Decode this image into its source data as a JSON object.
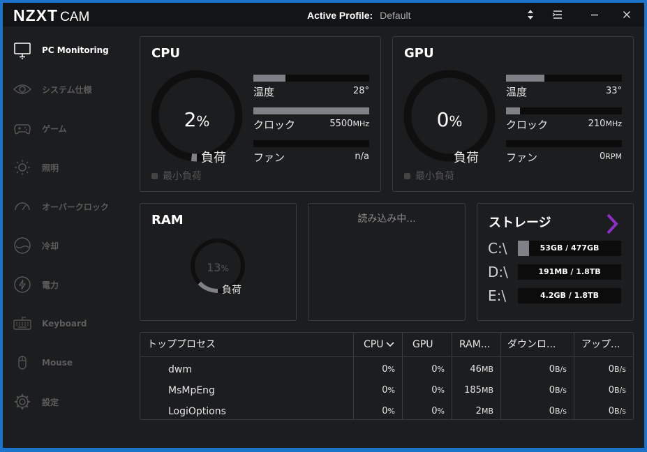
{
  "app": {
    "brand": "NZXT",
    "product": "CAM"
  },
  "header": {
    "profile_label": "Active Profile:",
    "profile_value": "Default"
  },
  "sidebar": {
    "items": [
      {
        "label": "PC Monitoring",
        "icon": "monitor-icon",
        "active": true
      },
      {
        "label": "システム仕様",
        "icon": "eye-icon"
      },
      {
        "label": "ゲーム",
        "icon": "gamepad-icon"
      },
      {
        "label": "照明",
        "icon": "light-icon"
      },
      {
        "label": "オーバークロック",
        "icon": "speedometer-icon"
      },
      {
        "label": "冷却",
        "icon": "cooling-icon"
      },
      {
        "label": "電力",
        "icon": "power-icon"
      },
      {
        "label": "Keyboard",
        "icon": "keyboard-icon"
      },
      {
        "label": "Mouse",
        "icon": "mouse-icon"
      },
      {
        "label": "設定",
        "icon": "gear-icon"
      }
    ]
  },
  "cpu": {
    "title": "CPU",
    "load_value": "2",
    "load_unit": "%",
    "load_fraction": 0.02,
    "load_label": "負荷",
    "min_load_label": "最小負荷",
    "temp_label": "温度",
    "temp_value": "28°",
    "temp_fraction": 0.28,
    "clock_label": "クロック",
    "clock_value": "5500",
    "clock_unit": "MHz",
    "clock_fraction": 1.0,
    "fan_label": "ファン",
    "fan_value": "n/a",
    "fan_unit": "",
    "fan_fraction": 0
  },
  "gpu": {
    "title": "GPU",
    "load_value": "0",
    "load_unit": "%",
    "load_fraction": 0.0,
    "load_label": "負荷",
    "min_load_label": "最小負荷",
    "temp_label": "温度",
    "temp_value": "33°",
    "temp_fraction": 0.33,
    "clock_label": "クロック",
    "clock_value": "210",
    "clock_unit": "MHz",
    "clock_fraction": 0.12,
    "fan_label": "ファン",
    "fan_value": "0",
    "fan_unit": "RPM",
    "fan_fraction": 0
  },
  "ram": {
    "title": "RAM",
    "load_value": "13",
    "load_unit": "%",
    "load_fraction": 0.13,
    "load_label": "負荷"
  },
  "middle": {
    "loading_text": "読み込み中..."
  },
  "storage": {
    "title": "ストレージ",
    "drives": [
      {
        "letter": "C:\\",
        "usage": "53GB / 477GB",
        "fraction": 0.11
      },
      {
        "letter": "D:\\",
        "usage": "191MB / 1.8TB",
        "fraction": 0
      },
      {
        "letter": "E:\\",
        "usage": "4.2GB / 1.8TB",
        "fraction": 0
      }
    ]
  },
  "processes": {
    "headers": {
      "name": "トッププロセス",
      "cpu": "CPU",
      "gpu": "GPU",
      "ram": "RAM...",
      "download": "ダウンロ...",
      "upload": "アップ..."
    },
    "rows": [
      {
        "name": "dwm",
        "cpu": "0",
        "cpu_unit": "%",
        "gpu": "0",
        "gpu_unit": "%",
        "ram": "46",
        "ram_unit": "MB",
        "down": "0",
        "down_unit": "B/s",
        "up": "0",
        "up_unit": "B/s"
      },
      {
        "name": "MsMpEng",
        "cpu": "0",
        "cpu_unit": "%",
        "gpu": "0",
        "gpu_unit": "%",
        "ram": "185",
        "ram_unit": "MB",
        "down": "0",
        "down_unit": "B/s",
        "up": "0",
        "up_unit": "B/s"
      },
      {
        "name": "LogiOptions",
        "cpu": "0",
        "cpu_unit": "%",
        "gpu": "0",
        "gpu_unit": "%",
        "ram": "2",
        "ram_unit": "MB",
        "down": "0",
        "down_unit": "B/s",
        "up": "0",
        "up_unit": "B/s"
      }
    ]
  },
  "colors": {
    "accent": "#8e2ec9",
    "bar": "#808087",
    "window_border": "#1b74c9"
  }
}
